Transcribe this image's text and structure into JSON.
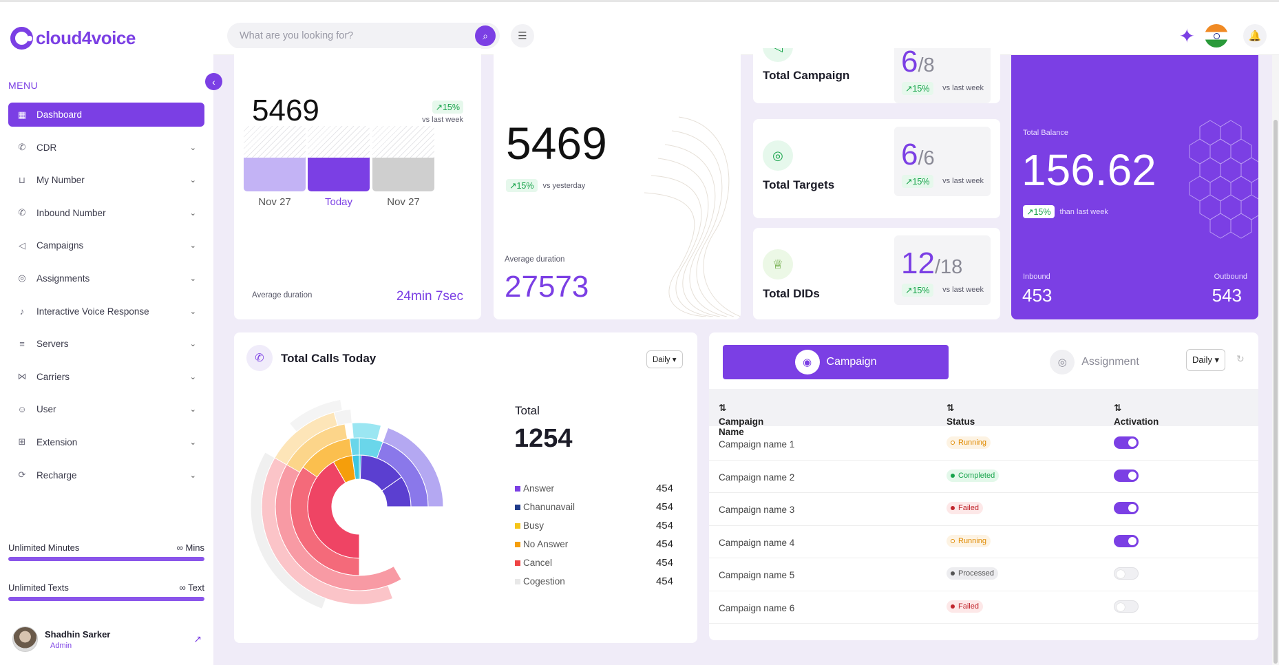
{
  "brand": {
    "name": "cloud4voice",
    "accent": "#7b3fe4"
  },
  "search": {
    "placeholder": "What are you looking for?"
  },
  "menu": {
    "title": "MENU"
  },
  "nav": [
    {
      "label": "Dashboard",
      "icon": "grid-icon",
      "active": true
    },
    {
      "label": "CDR",
      "icon": "phone-icon"
    },
    {
      "label": "My Number",
      "icon": "cart-icon"
    },
    {
      "label": "Inbound Number",
      "icon": "phone-incoming-icon"
    },
    {
      "label": "Campaigns",
      "icon": "megaphone-icon"
    },
    {
      "label": "Assignments",
      "icon": "target-icon"
    },
    {
      "label": "Interactive Voice Response",
      "icon": "mic-icon"
    },
    {
      "label": "Servers",
      "icon": "database-icon"
    },
    {
      "label": "Carriers",
      "icon": "network-icon"
    },
    {
      "label": "User",
      "icon": "user-icon"
    },
    {
      "label": "Extension",
      "icon": "extension-icon"
    },
    {
      "label": "Recharge",
      "icon": "recharge-icon"
    }
  ],
  "usage": [
    {
      "label": "Unlimited Minutes",
      "value": "∞ Mins"
    },
    {
      "label": "Unlimited Texts",
      "value": "∞ Text"
    }
  ],
  "profile": {
    "name": "Shadhin Sarker",
    "role": "Admin"
  },
  "card1": {
    "value": "5469",
    "growth": "↗15%",
    "growth_note": "vs last week",
    "bars": [
      {
        "label": "Nov 27",
        "fill": 0.52,
        "color": "#c3b3f5"
      },
      {
        "label": "Today",
        "fill": 0.52,
        "color": "#7b3fe4"
      },
      {
        "label": "Nov 27",
        "fill": 0.52,
        "color": "#cfcfcf"
      }
    ],
    "avg_label": "Average duration",
    "avg_value": "24min 7sec"
  },
  "card2": {
    "value": "5469",
    "growth": "↗15%",
    "growth_note": "vs yesterday",
    "avg_label": "Average duration",
    "avg_value": "27573"
  },
  "stats": [
    {
      "title": "Total Campaign",
      "num": "6",
      "den": "8",
      "growth": "↗15%",
      "note": "vs last week",
      "icon": "megaphone-icon"
    },
    {
      "title": "Total Targets",
      "num": "6",
      "den": "6",
      "growth": "↗15%",
      "note": "vs last week",
      "icon": "target-icon"
    },
    {
      "title": "Total DIDs",
      "num": "12",
      "den": "18",
      "growth": "↗15%",
      "note": "vs last week",
      "icon": "trophy-icon"
    }
  ],
  "balance": {
    "label": "Total Balance",
    "value": "156.62",
    "growth": "↗15%",
    "note": "than last week",
    "inbound_label": "Inbound",
    "inbound": "453",
    "outbound_label": "Outbound",
    "outbound": "543"
  },
  "calls": {
    "title": "Total Calls Today",
    "period": "Daily",
    "total_label": "Total",
    "total": "1254",
    "legend": [
      {
        "label": "Answer",
        "value": "454",
        "color": "#7b3fe4"
      },
      {
        "label": "Chanunavail",
        "value": "454",
        "color": "#1f3b8a"
      },
      {
        "label": "Busy",
        "value": "454",
        "color": "#f5c518"
      },
      {
        "label": "No Answer",
        "value": "454",
        "color": "#f59e0b"
      },
      {
        "label": "Cancel",
        "value": "454",
        "color": "#ef4444"
      },
      {
        "label": "Cogestion",
        "value": "454",
        "color": "#e8e8e8"
      }
    ]
  },
  "campaigns": {
    "tab_campaign": "Campaign",
    "tab_assignment": "Assignment",
    "period": "Daily",
    "col_name": "Campaign Name",
    "col_status": "Status",
    "col_activation": "Activation",
    "rows": [
      {
        "name": "Campaign name 1",
        "status": "Running",
        "active": true
      },
      {
        "name": "Campaign name 2",
        "status": "Completed",
        "active": true
      },
      {
        "name": "Campaign name 3",
        "status": "Failed",
        "active": true
      },
      {
        "name": "Campaign name 4",
        "status": "Running",
        "active": true
      },
      {
        "name": "Campaign name 5",
        "status": "Processed",
        "active": false
      },
      {
        "name": "Campaign name 6",
        "status": "Failed",
        "active": false
      }
    ]
  }
}
